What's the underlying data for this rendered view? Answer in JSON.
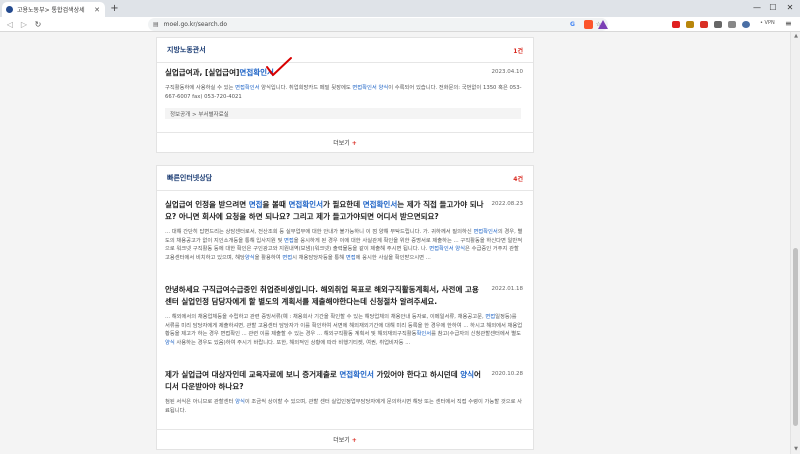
{
  "browser": {
    "tab_title": "고용노동부> 통합검색상세",
    "tab_close": "✕",
    "new_tab": "+",
    "url": "moel.go.kr/search.do",
    "vpn_label": "• VPN",
    "win_minimize": "—",
    "win_maximize": "☐",
    "win_close": "✕"
  },
  "section1": {
    "title": "지방노동관서",
    "count": "1건",
    "results": [
      {
        "title_pre": "실업급여과, [실업급여]",
        "title_hl": "면접확인서",
        "date": "2023.04.10",
        "body_1": "구직활동하에 사용하실 수 있는 ",
        "body_hl1": "면접확인서",
        "body_2": " 양식입니다. 취업희망카드 페밀 뒷장에도 ",
        "body_hl2": "면접확인서 양식",
        "body_3": "이 수록되어 있습니다. 전화문의: 국번없이 1350 혹은 053-667-6007 fax) 053-720-4021",
        "path": "정보공개 > 부서별자료실"
      }
    ],
    "more_label": "더보기",
    "more_plus": "+"
  },
  "section2": {
    "title": "빠른인터넷상담",
    "count": "4건",
    "results": [
      {
        "title_a": "실업급여 인정을 받으려면 ",
        "title_hl1": "면접",
        "title_b": "을 볼때 ",
        "title_hl2": "면접확인서",
        "title_c": "가 필요한데 ",
        "title_hl3": "면접확인서",
        "title_d": "는 제가 직접 들고가야 되나요? 아니면 회사에 요청을 하면 되나요? 그리고 제가 들고가야되면 어디서 받으면되요?",
        "date": "2022.08.23",
        "body_a": "... 대해 간단히 답변드리는 상담센터로서, 전산조회 등 실무업무에 대한 안내가 불가능하니 이 점 양해 부탁드립니다. 가. 귀하께서 질의하신 ",
        "body_hl1": "면접확인서",
        "body_b": "의 경우, 별도의 채용공고가 없이 지인소개등을 통해 입사지원 및 ",
        "body_hl2": "면접",
        "body_c": "을 응시하게 된 경우 이에 대한 사실관계 확인을 위한 증명서로 제출하는 ... 구직활동을 하신다면 일반적으로 워크넷 구직활동 등에 대한 확인은 구인광고와 지원내역(보냄)(워크넷) 출력물등을 같이 제출해 주시면 됩니다. 나. ",
        "body_hl3": "면접확인서 양식",
        "body_d": "은 수급중인 거주지 관할 고용센터에서 비치하고 있으며, 해당",
        "body_hl4": "양식",
        "body_e": "을 활용하여 ",
        "body_hl5": "면접",
        "body_f": "시 채용담당자등을 통해 ",
        "body_hl6": "면접",
        "body_g": "에 응시한 사실을 확인받으시면 ..."
      },
      {
        "title": "안녕하세요 구직급여수급중인 취업준비생입니다. 해외취업 목표로 해외구직활동계획서, 사전에 고용센터 실업인정 담당자에게 할 별도의 계획서를 제출해야한다는데 신청절차 알려주세요.",
        "date": "2022.01.18",
        "body_a": "... 해외에서의 채용업체등을 수립하고 관련 증빙서류(예 : 채용회사 기간을 확인할 수 있는 해당업체의 채용안내 등자료, 이메일서류, 채용공고문, ",
        "body_hl1": "면접",
        "body_b": "일정등)를 서류를 미리 담당자에게 제출하셔면, 관할 고용센터 담당자가 이를 확인하여 서면에 해외재외기간에 대해 미리 등록을 한 경우에 한하여 ... 하시고 해외에서 채용업황등을 제고가 하는 경우 면접확인 ... 관련 이를 제출할 수 있는 경우 ... 해외구직활동 계획서 및 해외재외구직활동",
        "body_hl2": "확인서",
        "body_c": "를 참고(수급자의 신청관할센터에서 별도 ",
        "body_hl3": "양식",
        "body_d": " 사용하는 경우도 있음)하여 주시기 바랍니다. 또한, 해외적인 상황에 따라 비행기티켓, 여권, 취업비자등 ..."
      },
      {
        "title_a": "제가 실업급여 대상자인데 교육자료에 보니 증거제출로 ",
        "title_hl1": "면접확인서",
        "title_b": " 가있어야 한다고 하시던데 ",
        "title_hl2": "양식",
        "title_c": "어디서 다운받아야 하나요?",
        "date": "2020.10.28",
        "body_a": "첨된 서식은 아니므로 관할센터 ",
        "body_hl1": "양식",
        "body_b": "이 조금씩 상이할 수 있으며, 관할 센터 실업인정업무담당자에게 문의하시면 해당 또는 센터에서 직접 수령이 가능할 것으로 사료됩니다."
      }
    ],
    "more_label": "더보기",
    "more_plus": "+"
  }
}
